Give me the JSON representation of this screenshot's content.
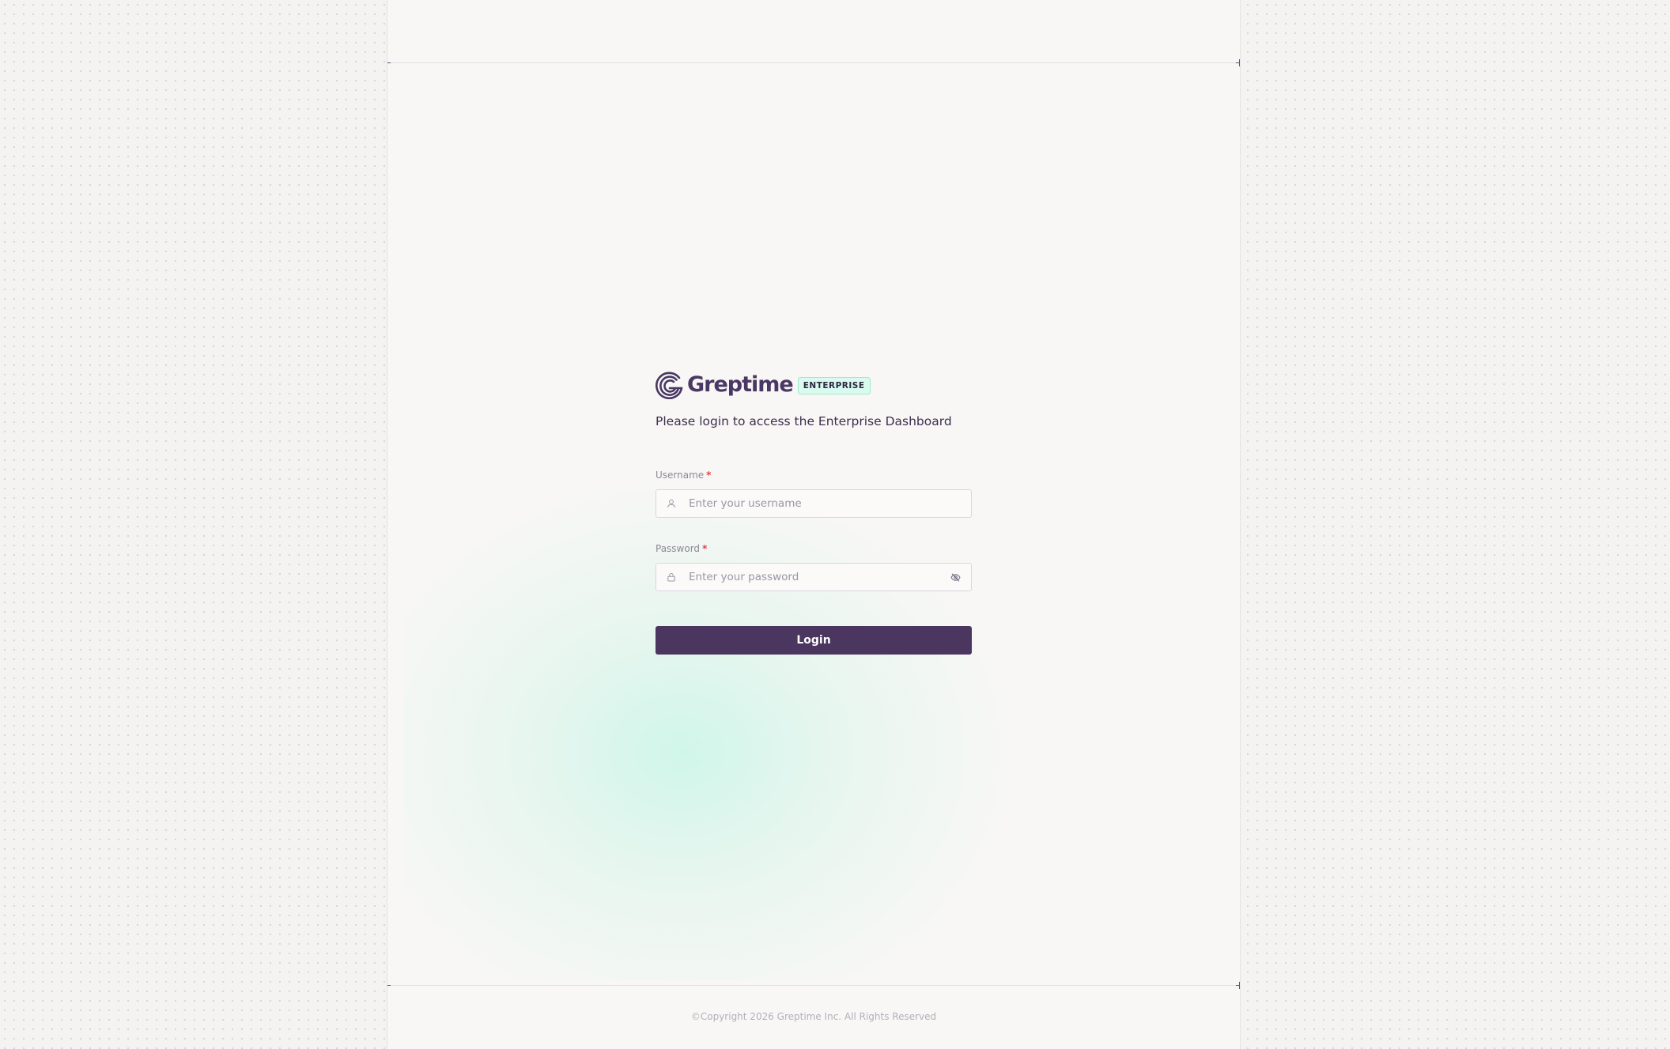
{
  "brand": {
    "name": "Greptime",
    "badge": "ENTERPRISE",
    "color": "#4a3763",
    "badge_bg": "#d8faef"
  },
  "login": {
    "subtitle": "Please login to access the Enterprise Dashboard",
    "username": {
      "label": "Username",
      "required_mark": "*",
      "placeholder": "Enter your username",
      "value": "",
      "icon": "user-icon"
    },
    "password": {
      "label": "Password",
      "required_mark": "*",
      "placeholder": "Enter your password",
      "value": "",
      "icon": "lock-icon",
      "toggle_icon": "eye-off-icon"
    },
    "submit_label": "Login",
    "button_color": "#4a365f"
  },
  "footer": {
    "copyright": "©Copyright 2026 Greptime Inc. All Rights Reserved"
  }
}
